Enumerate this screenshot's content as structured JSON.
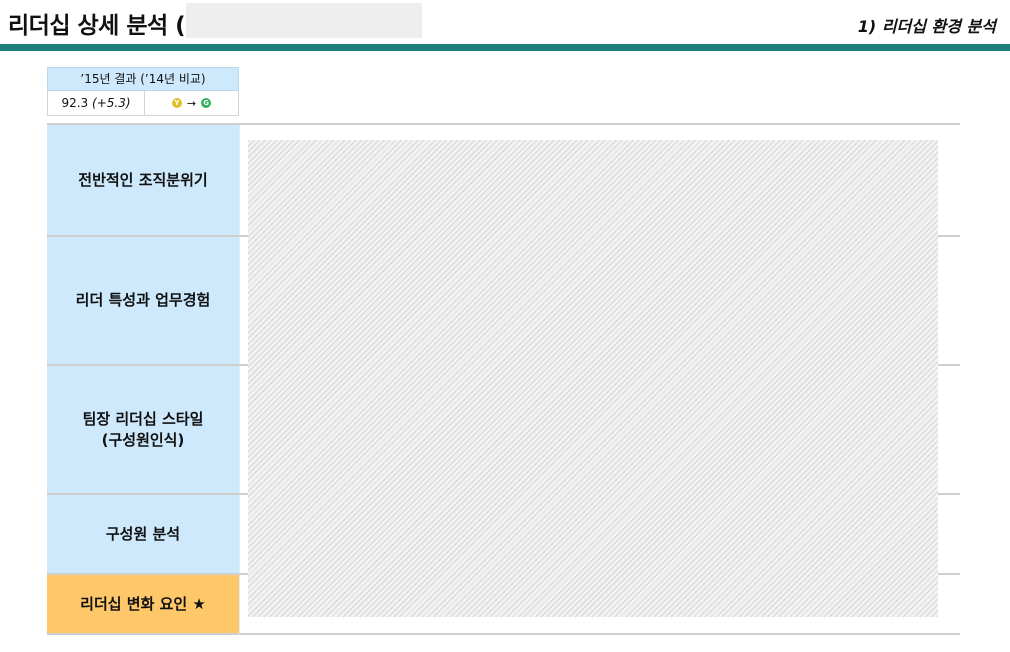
{
  "header": {
    "title": "리더십 상세 분석 (",
    "section": "1) 리더십 환경 분석"
  },
  "score": {
    "heading": "’15년 결과 (’14년 비교)",
    "value": "92.3",
    "change": "(+5.3)",
    "from_badge": "Y",
    "to_badge": "G",
    "arrow": "→"
  },
  "rows": [
    {
      "label": "전반적인 조직분위기"
    },
    {
      "label": "리더 특성과 업무경험"
    },
    {
      "label": "팀장 리더십 스타일\n(구성원인식)"
    },
    {
      "label": "구성원 분석"
    },
    {
      "label": "리더십 변화 요인 ★"
    }
  ],
  "colors": {
    "accent_bar": "#1a8079",
    "label_bg": "#cde9fb",
    "highlight_bg": "#fdc76a",
    "badge_yellow": "#e3c02a",
    "badge_green": "#2fae5c"
  }
}
